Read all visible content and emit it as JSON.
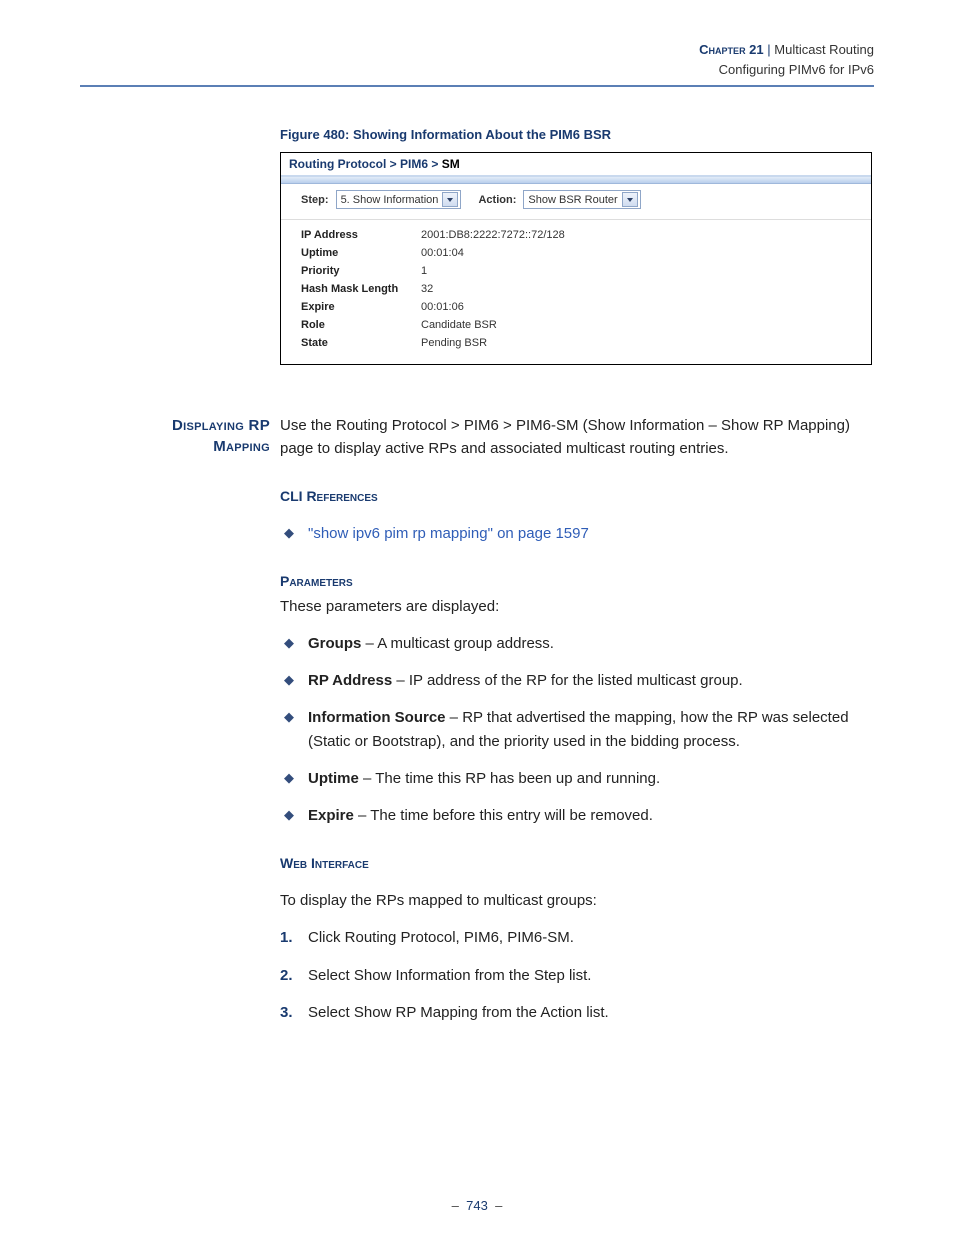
{
  "header": {
    "chapter_label": "Chapter 21",
    "separator": "|",
    "title": "Multicast Routing",
    "subtitle": "Configuring PIMv6 for IPv6"
  },
  "figure": {
    "caption": "Figure 480:  Showing Information About the PIM6 BSR",
    "breadcrumb": {
      "part1": "Routing Protocol >",
      "part2": "PIM6 >",
      "part3": "SM"
    },
    "controls": {
      "step_label": "Step:",
      "step_value": "5. Show Information",
      "action_label": "Action:",
      "action_value": "Show BSR Router"
    },
    "rows": [
      {
        "k": "IP Address",
        "v": "2001:DB8:2222:7272::72/128"
      },
      {
        "k": "Uptime",
        "v": "00:01:04"
      },
      {
        "k": "Priority",
        "v": "1"
      },
      {
        "k": "Hash Mask Length",
        "v": "32"
      },
      {
        "k": "Expire",
        "v": "00:01:06"
      },
      {
        "k": "Role",
        "v": "Candidate BSR"
      },
      {
        "k": "State",
        "v": "Pending BSR"
      }
    ]
  },
  "section": {
    "margin_title_l1": "Displaying RP",
    "margin_title_l2": "Mapping",
    "intro": "Use the Routing Protocol > PIM6 > PIM6-SM (Show Information – Show RP Mapping) page to display active RPs and associated multicast routing entries.",
    "cli_head": "CLI References",
    "cli_link": "\"show ipv6 pim rp mapping\" on page 1597",
    "params_head": "Parameters",
    "params_intro": "These parameters are displayed:",
    "params": [
      {
        "b": "Groups",
        "t": " – A multicast group address."
      },
      {
        "b": "RP Address",
        "t": " – IP address of the RP for the listed multicast group."
      },
      {
        "b": "Information Source",
        "t": " – RP that advertised the mapping, how the RP was selected (Static or Bootstrap), and the priority used in the bidding process."
      },
      {
        "b": "Uptime",
        "t": " – The time this RP has been up and running."
      },
      {
        "b": "Expire",
        "t": " – The time before this entry will be removed."
      }
    ],
    "web_head": "Web Interface",
    "web_intro": "To display the RPs mapped to multicast groups:",
    "steps": [
      "Click Routing Protocol, PIM6, PIM6-SM.",
      "Select Show Information from the Step list.",
      "Select Show RP Mapping from the Action list."
    ]
  },
  "footer": {
    "dash": "–",
    "page": "743"
  }
}
